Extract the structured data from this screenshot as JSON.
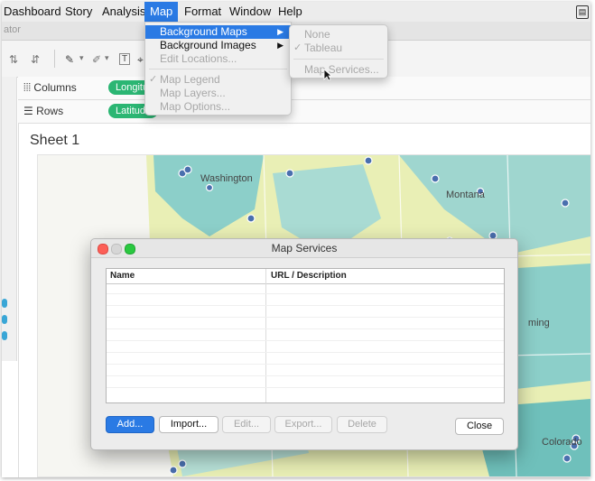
{
  "menubar": {
    "items": [
      "Dashboard",
      "Story",
      "Analysis",
      "Map",
      "Format",
      "Window",
      "Help"
    ],
    "active": "Map"
  },
  "titlebar": {
    "fragment": "ator"
  },
  "shelves": {
    "columns_label": "Columns",
    "columns_pill": "Longitude",
    "rows_label": "Rows",
    "rows_pill": "Latitude"
  },
  "sheet": {
    "title": "Sheet 1"
  },
  "map": {
    "labels": [
      "Washington",
      "Montana",
      "Wyoming",
      "Colorado"
    ]
  },
  "map_menu": {
    "items": [
      {
        "label": "Background Maps",
        "state": "highlighted",
        "submenu": true
      },
      {
        "label": "Background Images",
        "state": "normal",
        "submenu": true
      },
      {
        "label": "Edit Locations...",
        "state": "disabled"
      },
      {
        "label": "Map Legend",
        "state": "disabled",
        "checked": true
      },
      {
        "label": "Map Layers...",
        "state": "disabled"
      },
      {
        "label": "Map Options...",
        "state": "disabled"
      }
    ]
  },
  "background_maps_submenu": {
    "items": [
      {
        "label": "None",
        "state": "disabled"
      },
      {
        "label": "Tableau",
        "state": "disabled",
        "checked": true
      },
      {
        "label": "Map Services...",
        "state": "disabled"
      }
    ]
  },
  "dialog": {
    "title": "Map Services",
    "columns": [
      "Name",
      "URL / Description"
    ],
    "buttons": {
      "add": "Add...",
      "import": "Import...",
      "edit": "Edit...",
      "export": "Export...",
      "delete": "Delete",
      "close": "Close"
    }
  },
  "colors": {
    "accent": "#2a7ae4",
    "pill": "#2bb673",
    "map_teal": "#8ccfc9",
    "map_yellow": "#e9efb5",
    "marker": "#4a6fae"
  },
  "icons": [
    "checkmark-icon",
    "submenu-arrow-icon",
    "mouse-pointer-icon",
    "pen-icon",
    "text-icon",
    "sort-icon"
  ]
}
